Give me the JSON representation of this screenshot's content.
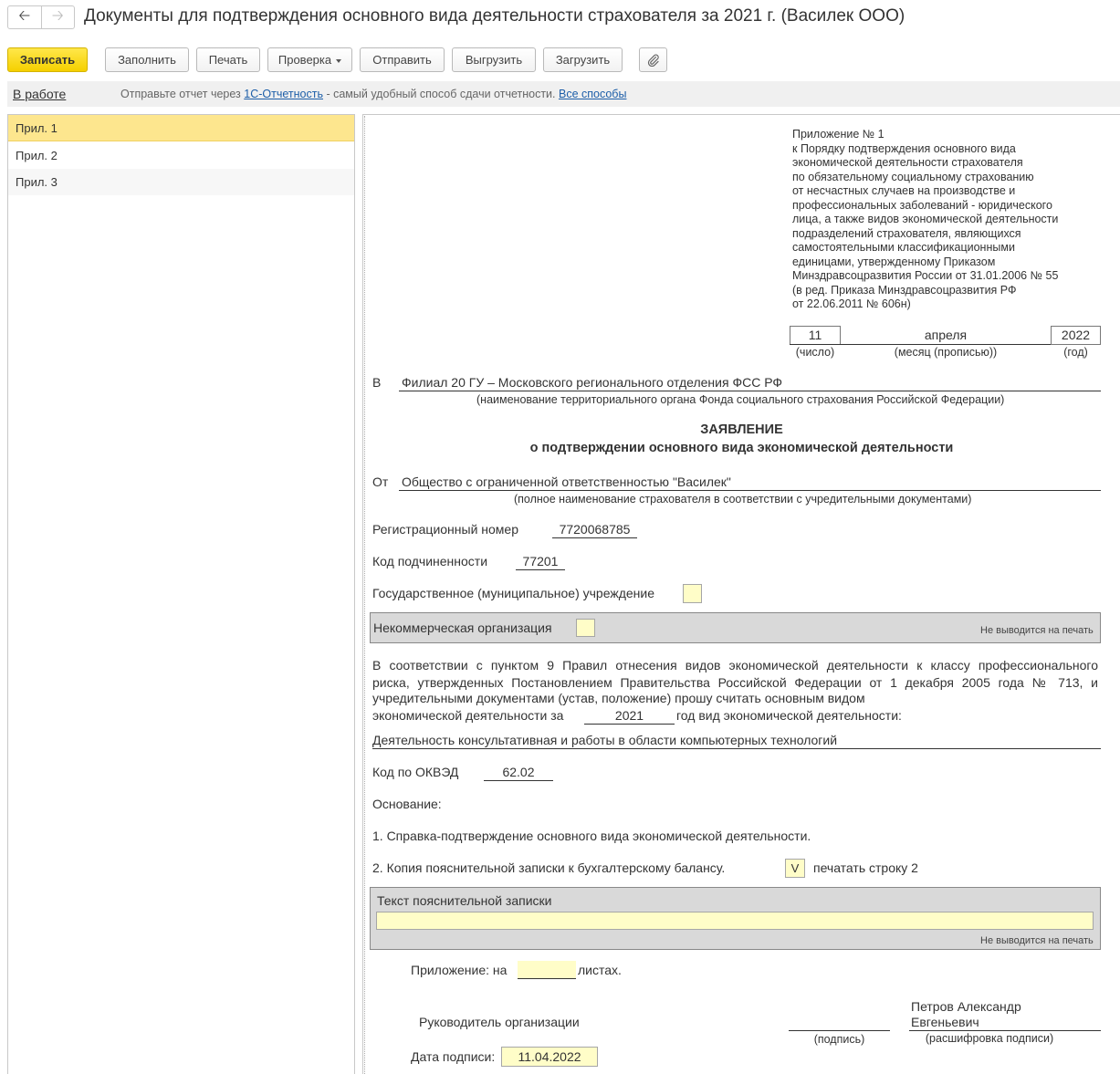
{
  "window": {
    "title": "Документы для подтверждения основного вида деятельности страхователя за 2021 г. (Василек ООО)",
    "back_icon": "arrow-left-icon",
    "forward_icon": "arrow-right-icon"
  },
  "toolbar": {
    "save": "Записать",
    "fill": "Заполнить",
    "print": "Печать",
    "check": "Проверка",
    "send": "Отправить",
    "export": "Выгрузить",
    "import": "Загрузить",
    "attach_icon": "paperclip-icon"
  },
  "infobar": {
    "status": "В работе",
    "text_before": "Отправьте отчет через ",
    "link_1c": "1С-Отчетность",
    "text_middle": " - самый удобный способ сдачи отчетности. ",
    "link_all": "Все способы"
  },
  "sections": [
    {
      "label": "Прил. 1"
    },
    {
      "label": "Прил. 2"
    },
    {
      "label": "Прил. 3"
    }
  ],
  "doc": {
    "appendix_header": [
      "Приложение № 1",
      "к Порядку подтверждения основного вида",
      "экономической деятельности страхователя",
      "по обязательному социальному страхованию",
      "от несчастных случаев на производстве и",
      "профессиональных заболеваний - юридического",
      "лица, а также видов экономической деятельности",
      "подразделений страхователя, являющихся",
      "самостоятельными классификационными",
      "единицами, утвержденному Приказом",
      "Минздравсоцразвития России от 31.01.2006 № 55",
      "(в ред. Приказа Минздравсоцразвития РФ",
      "от 22.06.2011 № 606н)"
    ],
    "date": {
      "day": "11",
      "month": "апреля",
      "year": "2022",
      "day_caption": "(число)",
      "month_caption": "(месяц (прописью))",
      "year_caption": "(год)"
    },
    "to_label": "В",
    "to_value": "Филиал 20 ГУ – Московского регионального отделения ФСС РФ",
    "to_caption": "(наименование территориального органа Фонда социального страхования Российской Федерации)",
    "heading_1": "ЗАЯВЛЕНИЕ",
    "heading_2": "о подтверждении основного вида экономической деятельности",
    "from_label": "От",
    "from_value": "Общество с ограниченной ответственностью \"Василек\"",
    "from_caption": "(полное наименование страхователя в соответствии с учредительными документами)",
    "reg_label": "Регистрационный номер",
    "reg_value": "7720068785",
    "sub_label": "Код подчиненности",
    "sub_value": "77201",
    "state_label": "Государственное (муниципальное) учреждение",
    "state_value": "",
    "nonprofit_label": "Некоммерческая организация",
    "nonprofit_value": "",
    "not_printed": "Не выводится на печать",
    "para_line1": "В соответствии с пунктом 9 Правил отнесения видов экономической деятельности к классу профессионального",
    "para_line2": "риска, утвержденных Постановлением Правительства Российской Федерации от 1 декабря 2005 года № 713, и",
    "para_line3": "учредительными документами (устав, положение) прошу считать основным видом",
    "para_line4_a": "экономической деятельности за",
    "para_year": "2021",
    "para_line4_b": "год вид экономической деятельности:",
    "activity": "Деятельность консультативная и работы в области компьютерных технологий",
    "okved_label": "Код по ОКВЭД",
    "okved_value": "62.02",
    "basis_label": "Основание:",
    "basis_1": "1. Справка-подтверждение основного вида экономической деятельности.",
    "basis_2": "2. Копия пояснительной записки к бухгалтерскому балансу.",
    "print_row2_check": "V",
    "print_row2_label": "печатать строку 2",
    "note_label": "Текст пояснительной записки",
    "note_value": "",
    "attach_label_a": "Приложение: на",
    "attach_value": "",
    "attach_label_b": "листах.",
    "head_label": "Руководитель организации",
    "signature_caption": "(подпись)",
    "head_name_1": "Петров Александр",
    "head_name_2": "Евгеньевич",
    "name_caption": "(расшифровка подписи)",
    "sign_date_label": "Дата подписи:",
    "sign_date_value": "11.04.2022"
  }
}
